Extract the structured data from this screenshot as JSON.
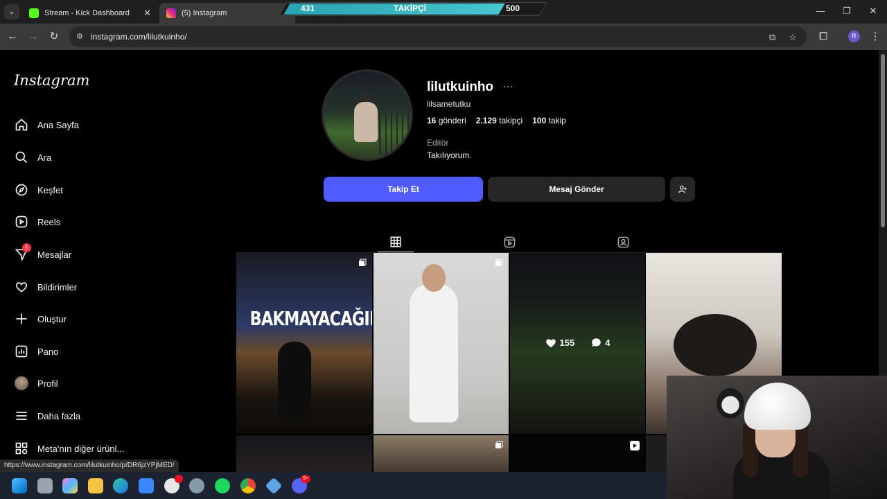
{
  "browser": {
    "tabs": [
      {
        "title": "Stream - Kick Dashboard",
        "favicon_color": "#53fc18"
      },
      {
        "title": "(5) Instagram",
        "favicon_color": "#e1306c"
      }
    ],
    "url": "instagram.com/lilutkuinho/",
    "status_url": "https://www.instagram.com/lilutkuinho/p/DR6jzYPjMED/",
    "profile_initial": "R"
  },
  "overlay": {
    "current": "431",
    "label": "TAKİPÇİ",
    "goal": "500",
    "progress_fraction": 0.862
  },
  "sidebar": {
    "logo": "Instagram",
    "items": [
      {
        "label": "Ana Sayfa",
        "icon": "home-icon"
      },
      {
        "label": "Ara",
        "icon": "search-icon"
      },
      {
        "label": "Keşfet",
        "icon": "compass-icon"
      },
      {
        "label": "Reels",
        "icon": "reels-icon"
      },
      {
        "label": "Mesajlar",
        "icon": "messenger-icon",
        "badge": "5"
      },
      {
        "label": "Bildirimler",
        "icon": "heart-icon"
      },
      {
        "label": "Oluştur",
        "icon": "plus-icon"
      },
      {
        "label": "Pano",
        "icon": "dashboard-icon"
      },
      {
        "label": "Profil",
        "icon": "profile-avatar-icon"
      },
      {
        "label": "Daha fazla",
        "icon": "menu-icon"
      },
      {
        "label": "Meta'nın diğer ürünl...",
        "icon": "meta-apps-icon"
      }
    ]
  },
  "profile": {
    "username": "lilutkuinho",
    "full_name": "lilsametutku",
    "posts_count": "16",
    "posts_label": "gönderi",
    "followers_count": "2.129",
    "followers_label": "takipçi",
    "following_count": "100",
    "following_label": "takip",
    "category": "Editör",
    "bio": "Takılıyorum.",
    "follow_label": "Takip Et",
    "message_label": "Mesaj Gönder"
  },
  "hover_post": {
    "likes": "155",
    "comments": "4"
  },
  "grid_posts": [
    {
      "caption": "BAKMAYACAĞIM"
    }
  ],
  "colors": {
    "accent": "#4f5bff",
    "notification": "#ff3040",
    "overlay_bar": "#47c6cf"
  }
}
